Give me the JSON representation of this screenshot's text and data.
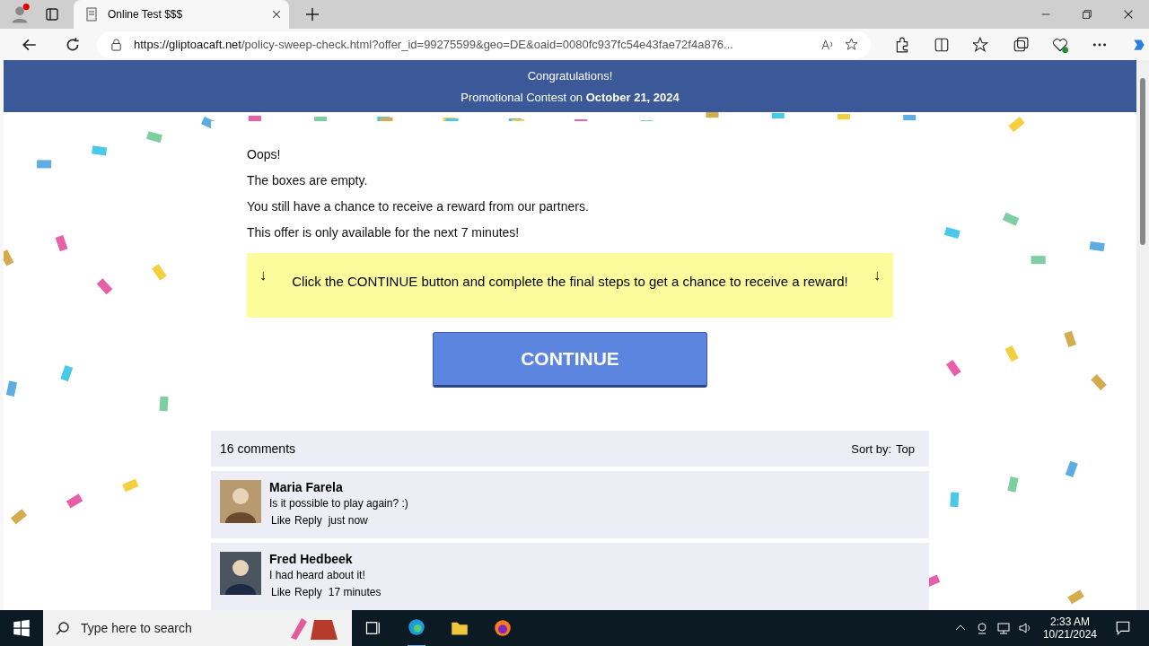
{
  "browser": {
    "tab_title": "Online Test $$$",
    "url_host": "https://gliptoacaft.net",
    "url_path": "/policy-sweep-check.html?offer_id=99275599&geo=DE&oaid=0080fc937fc54e43fae72f4a876..."
  },
  "header": {
    "line1": "Congratulations!",
    "line2": "Promotional Contest on **October 21, 2024**"
  },
  "messages": [
    "Oops!",
    "The boxes are empty.",
    "You still have a chance to receive a reward from our partners.",
    "This offer is only available for the next 7 minutes!"
  ],
  "notice": {
    "arrow_left": "↓",
    "text": "Click the CONTINUE button and complete the final steps to get a chance to receive a reward!",
    "arrow_right": "↓"
  },
  "continue_button": "CONTINUE",
  "comments_bar": {
    "count": "16 comments",
    "sort_label": "Sort by:",
    "sort_value": "Top"
  },
  "comments": [
    {
      "author": "Maria Farela",
      "text": "Is it possible to play again? :)",
      "like": "Like",
      "reply": "Reply",
      "time": "just now"
    },
    {
      "author": "Fred Hedbeek",
      "text": "I had heard about it!",
      "like": "Like",
      "reply": "Reply",
      "time": "17 minutes"
    }
  ],
  "taskbar": {
    "search_placeholder": "Type here to search",
    "time": "2:33 AM",
    "date": "10/21/2024"
  }
}
